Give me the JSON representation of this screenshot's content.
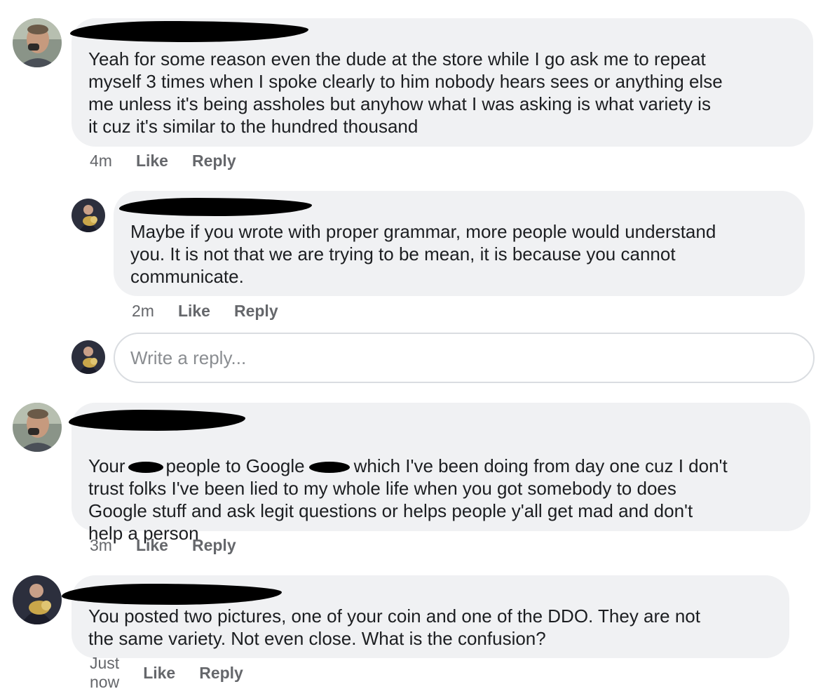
{
  "comments": [
    {
      "text": "Yeah for some reason even the dude at the store while I go ask me to repeat\nmyself 3 times when I spoke clearly to him nobody hears sees or anything else\nme unless it's being assholes but anyhow what I was asking is what variety is\nit cuz it's similar to the hundred thousand",
      "time": "4m",
      "like": "Like",
      "reply": "Reply"
    },
    {
      "text": "Maybe if you wrote with proper grammar, more people would understand\nyou. It is not that we are trying to be mean, it is because you cannot\ncommunicate.",
      "time": "2m",
      "like": "Like",
      "reply": "Reply"
    },
    {
      "text_a": "Your",
      "text_b": "people to Google",
      "text_c": "which I've been doing from day one cuz I don't",
      "text_rest": "trust folks I've been lied to my whole life when you got somebody to does\nGoogle stuff and ask legit questions or helps people y'all get mad and don't\nhelp a person",
      "time": "3m",
      "like": "Like",
      "reply": "Reply"
    },
    {
      "text": "You posted two pictures, one of your coin and one of the DDO. They are not\nthe same variety. Not even close. What is the confusion?",
      "time": "Just now",
      "like": "Like",
      "reply": "Reply"
    }
  ],
  "reply_box": {
    "placeholder": "Write a reply..."
  },
  "icons": {
    "avatar_a": "user-avatar-photo",
    "avatar_b": "user-avatar-photo-instrument"
  },
  "colors": {
    "bubble": "#f0f1f3",
    "meta": "#65676b",
    "text": "#1c1e21"
  }
}
